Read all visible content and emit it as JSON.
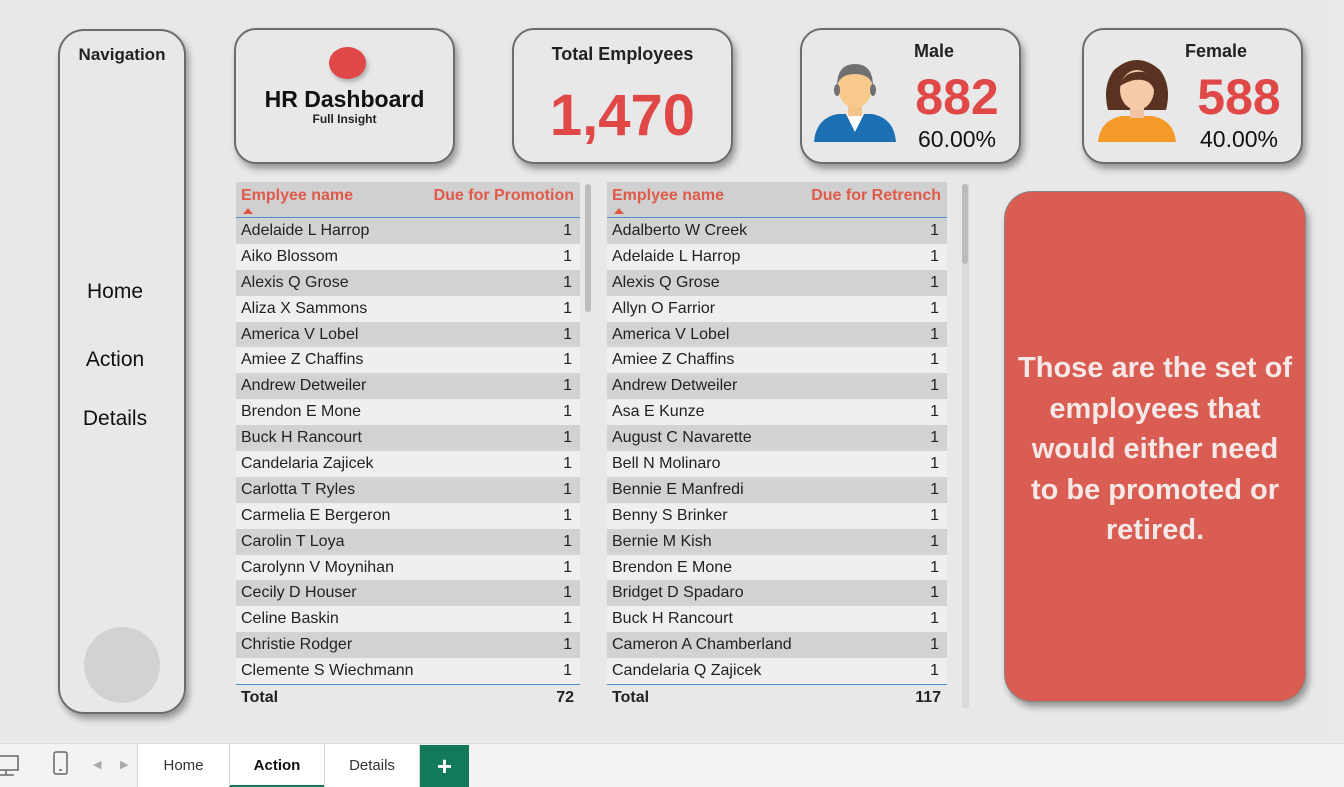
{
  "nav": {
    "title": "Navigation",
    "items": [
      "Home",
      "Action",
      "Details"
    ]
  },
  "logo": {
    "title": "HR Dashboard",
    "subtitle": "Full Insight"
  },
  "total": {
    "title": "Total Employees",
    "value": "1,470"
  },
  "male": {
    "title": "Male",
    "value": "882",
    "pct": "60.00%",
    "icon": "male-avatar-icon"
  },
  "female": {
    "title": "Female",
    "value": "588",
    "pct": "40.00%",
    "icon": "female-avatar-icon"
  },
  "promotion": {
    "col1": "Emplyee name",
    "col2": "Due for Promotion",
    "rows": [
      [
        "Adelaide L Harrop",
        "1"
      ],
      [
        "Aiko Blossom",
        "1"
      ],
      [
        "Alexis Q Grose",
        "1"
      ],
      [
        "Aliza X Sammons",
        "1"
      ],
      [
        "America V Lobel",
        "1"
      ],
      [
        "Amiee Z Chaffins",
        "1"
      ],
      [
        "Andrew Detweiler",
        "1"
      ],
      [
        "Brendon E Mone",
        "1"
      ],
      [
        "Buck H Rancourt",
        "1"
      ],
      [
        "Candelaria Zajicek",
        "1"
      ],
      [
        "Carlotta T Ryles",
        "1"
      ],
      [
        "Carmelia E Bergeron",
        "1"
      ],
      [
        "Carolin T Loya",
        "1"
      ],
      [
        "Carolynn V Moynihan",
        "1"
      ],
      [
        "Cecily D Houser",
        "1"
      ],
      [
        "Celine Baskin",
        "1"
      ],
      [
        "Christie Rodger",
        "1"
      ],
      [
        "Clemente S Wiechmann",
        "1"
      ]
    ],
    "total_label": "Total",
    "total": "72"
  },
  "retrench": {
    "col1": "Emplyee name",
    "col2": "Due for Retrench",
    "rows": [
      [
        "Adalberto W Creek",
        "1"
      ],
      [
        "Adelaide L Harrop",
        "1"
      ],
      [
        "Alexis Q Grose",
        "1"
      ],
      [
        "Allyn O Farrior",
        "1"
      ],
      [
        "America V Lobel",
        "1"
      ],
      [
        "Amiee Z Chaffins",
        "1"
      ],
      [
        "Andrew Detweiler",
        "1"
      ],
      [
        "Asa E Kunze",
        "1"
      ],
      [
        "August C Navarette",
        "1"
      ],
      [
        "Bell N Molinaro",
        "1"
      ],
      [
        "Bennie E Manfredi",
        "1"
      ],
      [
        "Benny S Brinker",
        "1"
      ],
      [
        "Bernie M Kish",
        "1"
      ],
      [
        "Brendon E Mone",
        "1"
      ],
      [
        "Bridget D Spadaro",
        "1"
      ],
      [
        "Buck H Rancourt",
        "1"
      ],
      [
        "Cameron A Chamberland",
        "1"
      ],
      [
        "Candelaria Q Zajicek",
        "1"
      ]
    ],
    "total_label": "Total",
    "total": "117"
  },
  "note": {
    "text": "Those are the set of employees that would either need to be promoted or retired."
  },
  "tabs": {
    "items": [
      "Home",
      "Action",
      "Details"
    ],
    "active": "Action",
    "add_label": "+"
  },
  "colors": {
    "accent": "#e04848",
    "note_bg": "#d95d52",
    "tab_green": "#127a5a"
  }
}
